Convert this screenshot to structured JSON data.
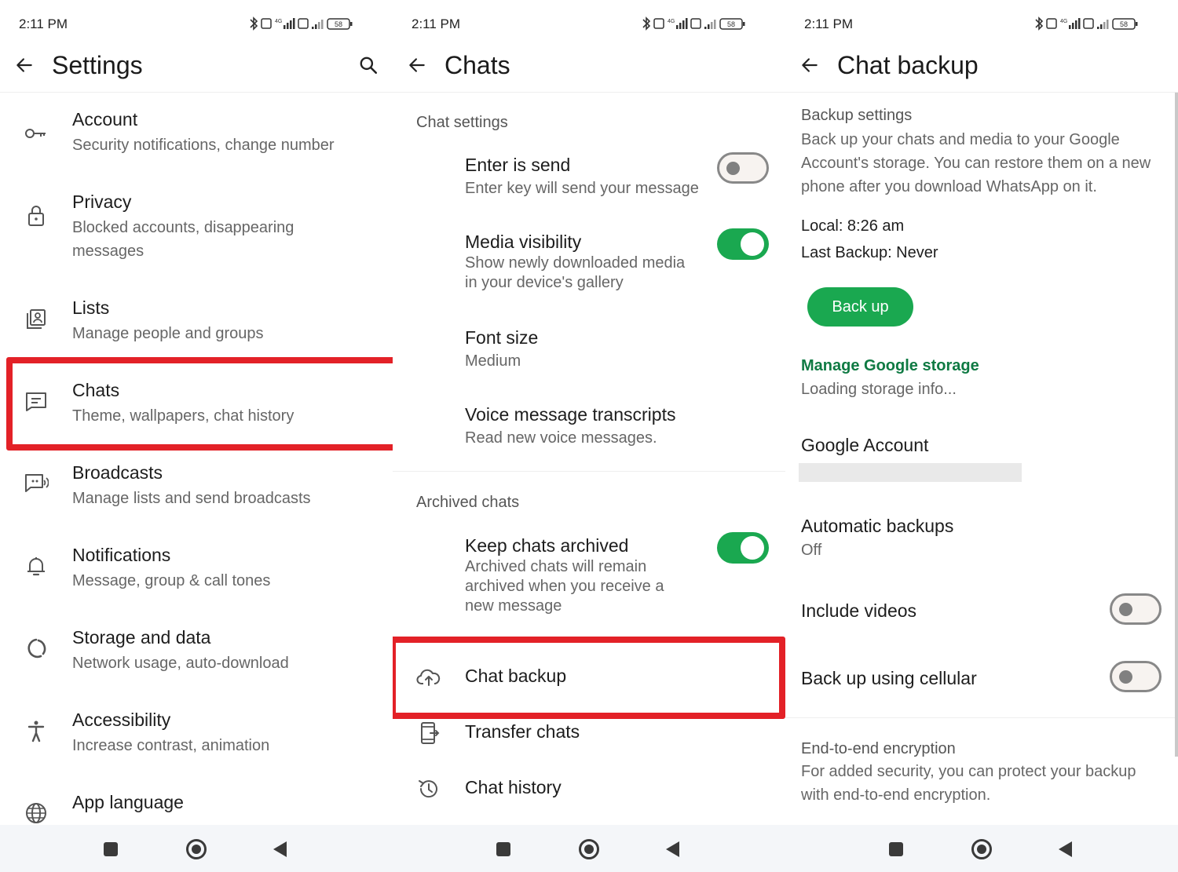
{
  "status": {
    "time": "2:11 PM",
    "battery": "58"
  },
  "settings": {
    "title": "Settings",
    "items": [
      {
        "title": "Account",
        "subtitle": "Security notifications, change number",
        "icon": "key-icon"
      },
      {
        "title": "Privacy",
        "subtitle": "Blocked accounts, disappearing messages",
        "icon": "lock-icon"
      },
      {
        "title": "Lists",
        "subtitle": "Manage people and groups",
        "icon": "contact-list-icon"
      },
      {
        "title": "Chats",
        "subtitle": "Theme, wallpapers, chat history",
        "icon": "chat-icon"
      },
      {
        "title": "Broadcasts",
        "subtitle": "Manage lists and send broadcasts",
        "icon": "broadcast-icon"
      },
      {
        "title": "Notifications",
        "subtitle": "Message, group & call tones",
        "icon": "bell-icon"
      },
      {
        "title": "Storage and data",
        "subtitle": "Network usage, auto-download",
        "icon": "storage-icon"
      },
      {
        "title": "Accessibility",
        "subtitle": "Increase contrast, animation",
        "icon": "accessibility-icon"
      },
      {
        "title": "App language",
        "subtitle": "",
        "icon": "globe-icon"
      }
    ]
  },
  "chats": {
    "title": "Chats",
    "chat_settings_header": "Chat settings",
    "enter_is_send": {
      "title": "Enter is send",
      "subtitle": "Enter key will send your message",
      "enabled": false
    },
    "media_visibility": {
      "title": "Media visibility",
      "subtitle": "Show newly downloaded media in your device's gallery",
      "enabled": true
    },
    "font_size": {
      "title": "Font size",
      "value": "Medium"
    },
    "voice_transcripts": {
      "title": "Voice message transcripts",
      "subtitle": "Read new voice messages."
    },
    "archived_header": "Archived chats",
    "keep_archived": {
      "title": "Keep chats archived",
      "subtitle": "Archived chats will remain archived when you receive a new message",
      "enabled": true
    },
    "chat_backup": "Chat backup",
    "transfer_chats": "Transfer chats",
    "chat_history": "Chat history"
  },
  "backup": {
    "title": "Chat backup",
    "settings_header": "Backup settings",
    "description": "Back up your chats and media to your Google Account's storage. You can restore them on a new phone after you download WhatsApp on it.",
    "local": "Local: 8:26 am",
    "last_backup": "Last Backup: Never",
    "backup_button": "Back up",
    "manage_storage": "Manage Google storage",
    "storage_info": "Loading storage info...",
    "google_account": "Google Account",
    "auto_backups": {
      "title": "Automatic backups",
      "value": "Off"
    },
    "include_videos": {
      "title": "Include videos",
      "enabled": false
    },
    "cellular": {
      "title": "Back up using cellular",
      "enabled": false
    },
    "e2e_header": "End-to-end encryption",
    "e2e_desc": "For added security, you can protect your backup with end-to-end encryption."
  },
  "colors": {
    "accent": "#1aa850",
    "link": "#0f7a43",
    "highlight": "#e32127"
  }
}
